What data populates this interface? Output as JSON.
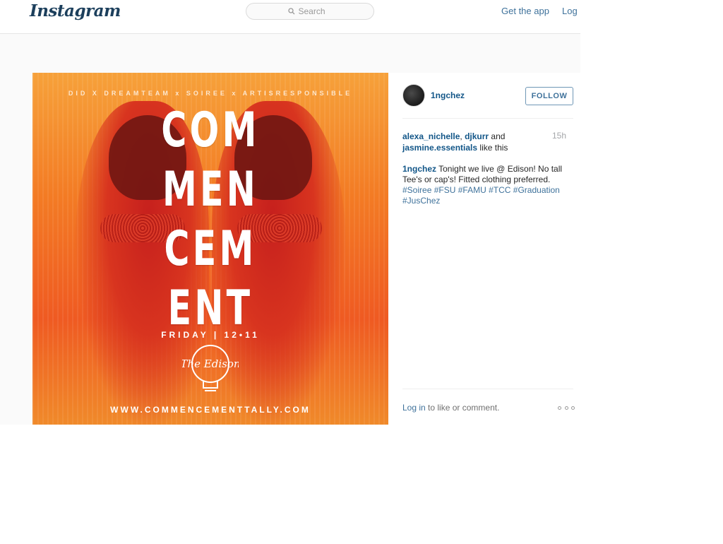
{
  "header": {
    "logo": "Instagram",
    "search_placeholder": "Search",
    "get_app": "Get the app",
    "login": "Log"
  },
  "post": {
    "image": {
      "alt_text_lines": {
        "top": "DID X DREAMTEAM x SOIREE x ARTISRESPONSIBLE",
        "title": "COM\nMEN\nCEM\nENT",
        "date": "FRIDAY | 12•11",
        "venue": "The Edison",
        "url": "WWW.COMMENCEMENTTALLY.COM"
      }
    },
    "username": "1ngchez",
    "follow_label": "FOLLOW",
    "likes": {
      "users": [
        "alexa_nichelle",
        "djkurr",
        "jasmine.essentials"
      ],
      "sep1": ", ",
      "and": " and ",
      "suffix": " like this"
    },
    "time_ago": "15h",
    "caption": {
      "user": "1ngchez",
      "text": " Tonight we live @ Edison! No tall Tee's or cap's! Fitted clothing preferred. ",
      "hashtags": [
        "#Soiree",
        "#FSU",
        "#FAMU",
        "#TCC",
        "#Graduation",
        "#JusChez"
      ]
    },
    "comment_prompt": {
      "login_link": "Log in",
      "rest": " to like or comment."
    }
  },
  "colors": {
    "link_blue": "#3f729b",
    "username_blue": "#125688",
    "logo": "#1c3f5c"
  }
}
